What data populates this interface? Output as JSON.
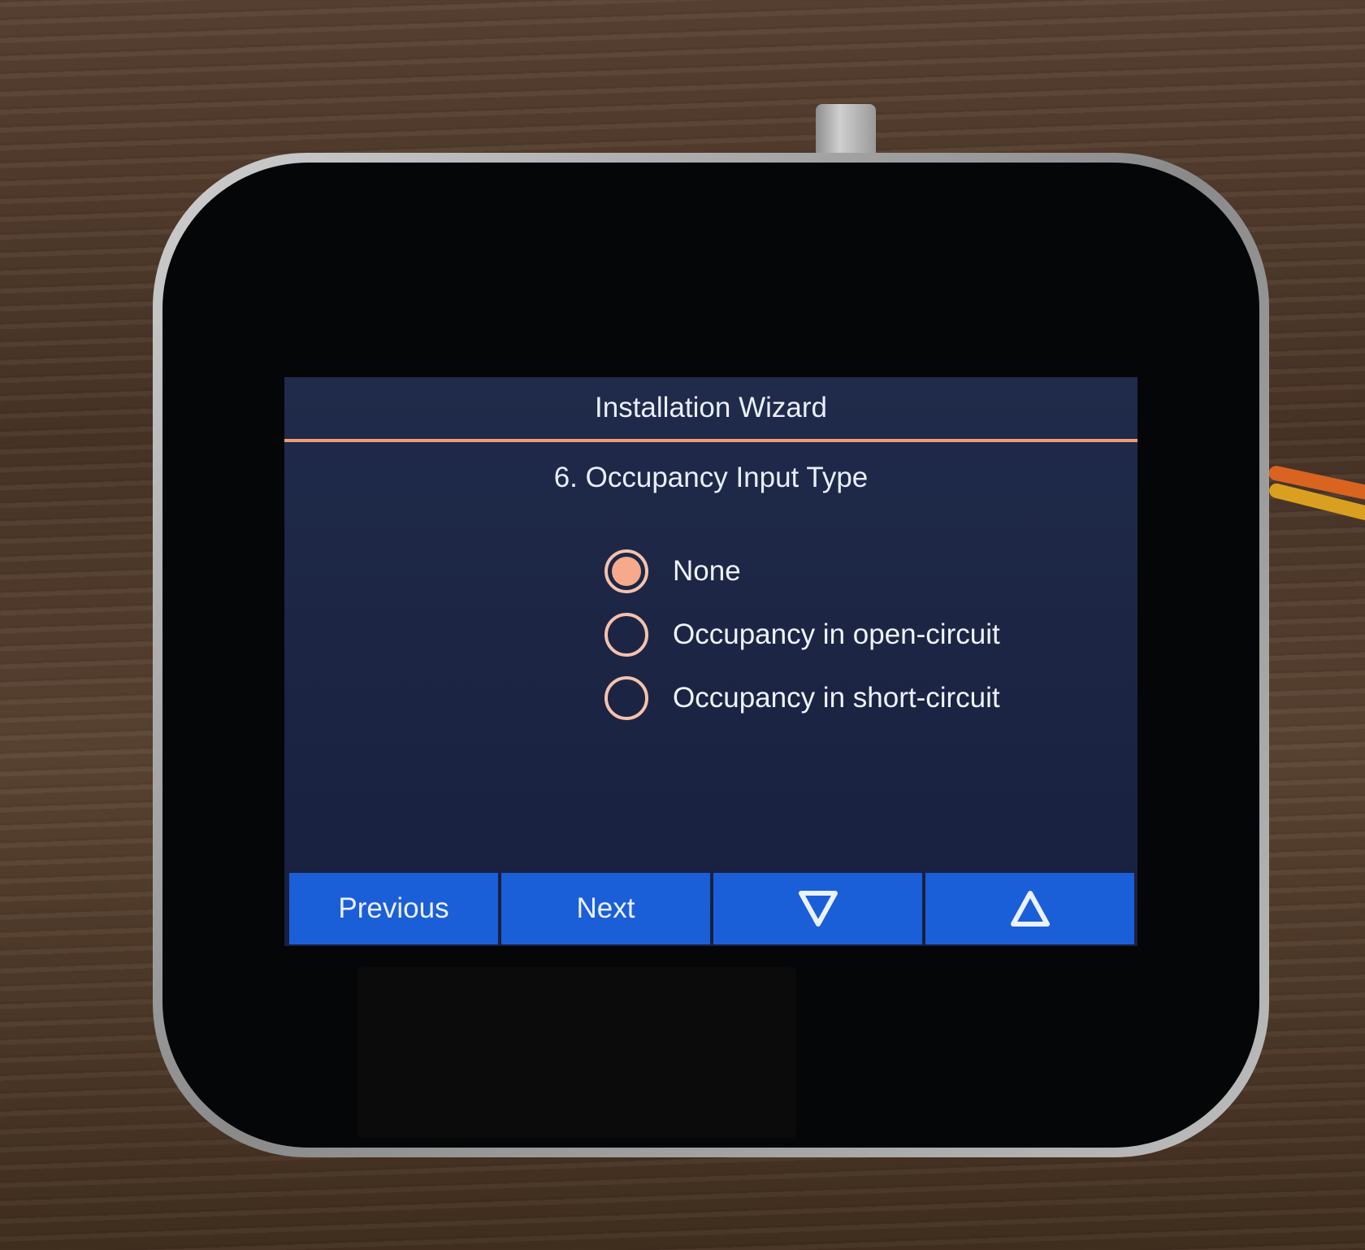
{
  "header": {
    "title": "Installation Wizard"
  },
  "step": {
    "title": "6. Occupancy Input Type"
  },
  "options": [
    {
      "label": "None",
      "selected": true
    },
    {
      "label": "Occupancy in open-circuit",
      "selected": false
    },
    {
      "label": "Occupancy in short-circuit",
      "selected": false
    }
  ],
  "nav": {
    "previous_label": "Previous",
    "next_label": "Next",
    "down_icon": "triangle-down-icon",
    "up_icon": "triangle-up-icon"
  },
  "colors": {
    "accent": "#f19a78",
    "button_blue": "#1b5fd8",
    "screen_bg": "#1b2442"
  }
}
